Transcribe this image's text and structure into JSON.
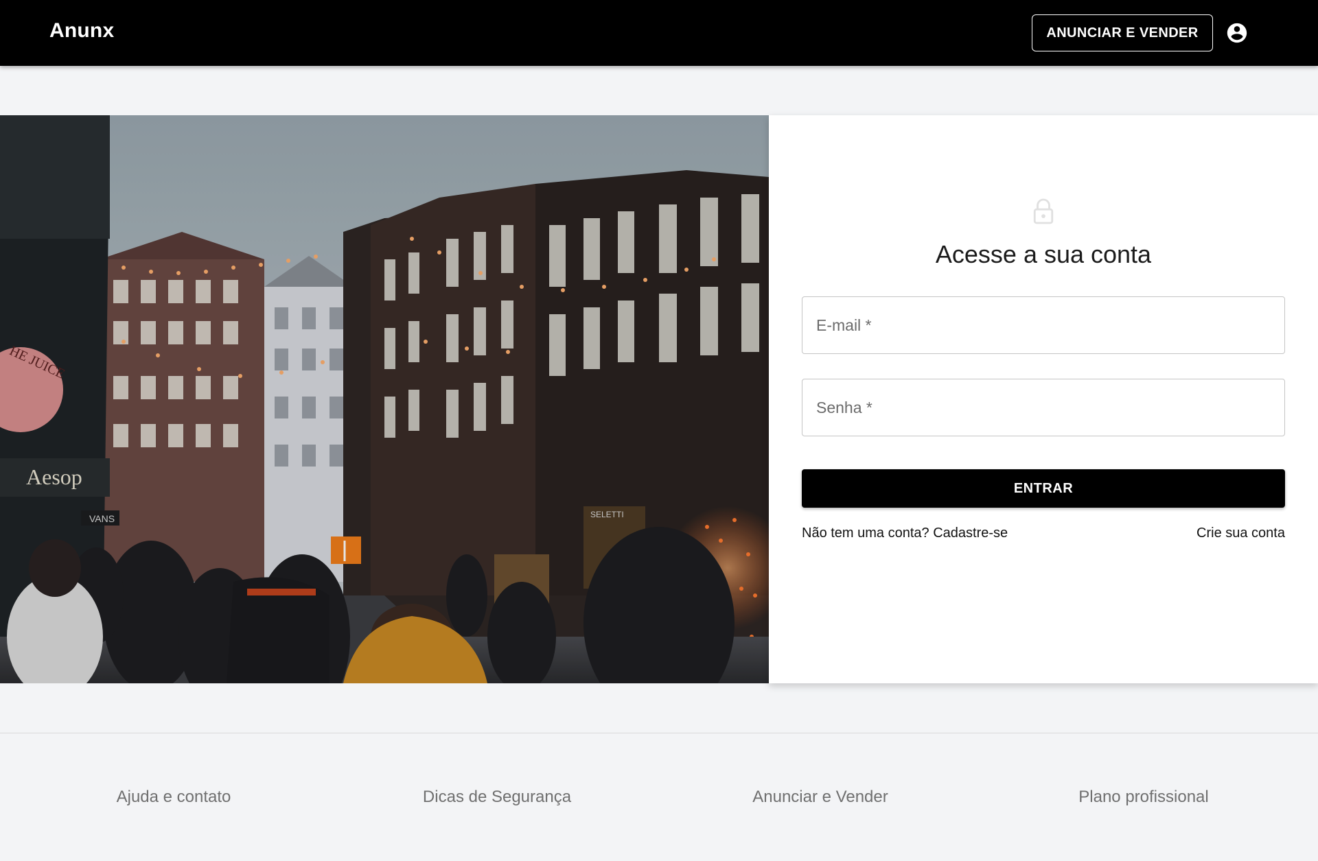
{
  "header": {
    "brand": "Anunx",
    "sell_button": "ANUNCIAR E VENDER",
    "account_icon": "account-circle-icon"
  },
  "hero": {
    "image": "street-scene-photo",
    "sign_text": "Aesop",
    "sign_text_2": "HE JUICE",
    "sign_text_3": "VANS",
    "sign_text_4": "SELETTI"
  },
  "login": {
    "lock_icon": "lock-icon",
    "title": "Acesse a sua conta",
    "email_label": "E-mail *",
    "password_label": "Senha *",
    "submit_label": "ENTRAR",
    "signup_prompt": "Não tem uma conta? Cadastre-se",
    "signup_link": "Crie sua conta"
  },
  "footer": {
    "links": [
      "Ajuda e contato",
      "Dicas de Segurança",
      "Anunciar e Vender",
      "Plano profissional"
    ]
  },
  "colors": {
    "header_bg": "#000000",
    "page_bg": "#f3f4f6",
    "button_bg": "#000000",
    "footer_text": "#6f6f6f"
  }
}
